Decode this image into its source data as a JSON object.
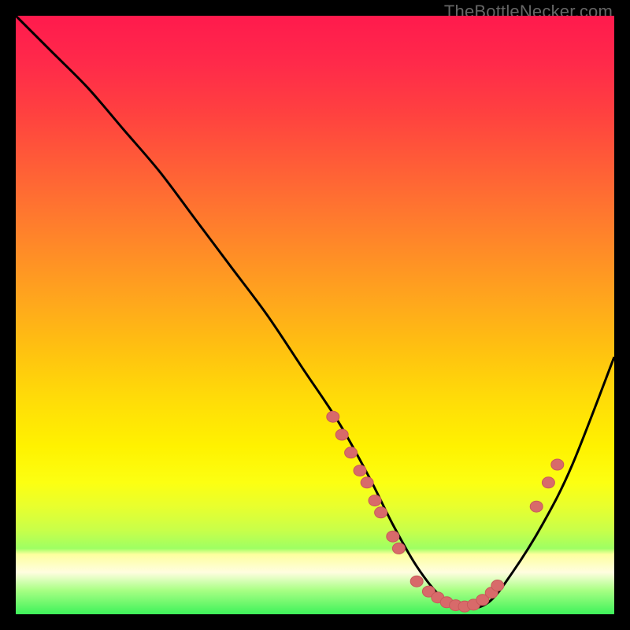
{
  "attribution": "TheBottleNecker.com",
  "chart_data": {
    "type": "line",
    "title": "",
    "xlabel": "",
    "ylabel": "",
    "xlim": [
      0,
      100
    ],
    "ylim": [
      0,
      100
    ],
    "series": [
      {
        "name": "curve",
        "x": [
          0,
          6,
          12,
          18,
          24,
          30,
          36,
          42,
          48,
          54,
          59,
          63,
          67,
          71,
          75,
          79,
          83,
          88,
          93,
          100
        ],
        "values": [
          100,
          94,
          88,
          81,
          74,
          66,
          58,
          50,
          41,
          32,
          23,
          15,
          8,
          3,
          1,
          2,
          7,
          15,
          25,
          43
        ]
      }
    ],
    "markers": [
      {
        "name": "cluster-left-arm",
        "x": 53,
        "y": 33
      },
      {
        "name": "cluster-left-arm",
        "x": 54.5,
        "y": 30
      },
      {
        "name": "cluster-left-arm",
        "x": 56,
        "y": 27
      },
      {
        "name": "cluster-left-arm",
        "x": 57.5,
        "y": 24
      },
      {
        "name": "cluster-left-arm",
        "x": 58.7,
        "y": 22
      },
      {
        "name": "cluster-left-arm",
        "x": 60,
        "y": 19
      },
      {
        "name": "cluster-left-arm",
        "x": 61,
        "y": 17
      },
      {
        "name": "cluster-left-arm",
        "x": 63,
        "y": 13
      },
      {
        "name": "cluster-left-arm",
        "x": 64,
        "y": 11
      },
      {
        "name": "cluster-valley",
        "x": 67,
        "y": 5.5
      },
      {
        "name": "cluster-valley",
        "x": 69,
        "y": 3.8
      },
      {
        "name": "cluster-valley",
        "x": 70.5,
        "y": 2.8
      },
      {
        "name": "cluster-valley",
        "x": 72,
        "y": 2.0
      },
      {
        "name": "cluster-valley",
        "x": 73.5,
        "y": 1.5
      },
      {
        "name": "cluster-valley",
        "x": 75,
        "y": 1.3
      },
      {
        "name": "cluster-valley",
        "x": 76.5,
        "y": 1.6
      },
      {
        "name": "cluster-valley",
        "x": 78,
        "y": 2.4
      },
      {
        "name": "cluster-valley",
        "x": 79.5,
        "y": 3.6
      },
      {
        "name": "cluster-valley",
        "x": 80.5,
        "y": 4.8
      },
      {
        "name": "cluster-right-arm",
        "x": 87,
        "y": 18
      },
      {
        "name": "cluster-right-arm",
        "x": 89,
        "y": 22
      },
      {
        "name": "cluster-right-arm",
        "x": 90.5,
        "y": 25
      }
    ],
    "colors": {
      "curve": "#000000",
      "marker_fill": "#d86a6a",
      "marker_stroke": "#c85a5a",
      "gradient_top": "#ff1a4d",
      "gradient_bottom": "#3ef25a"
    }
  }
}
